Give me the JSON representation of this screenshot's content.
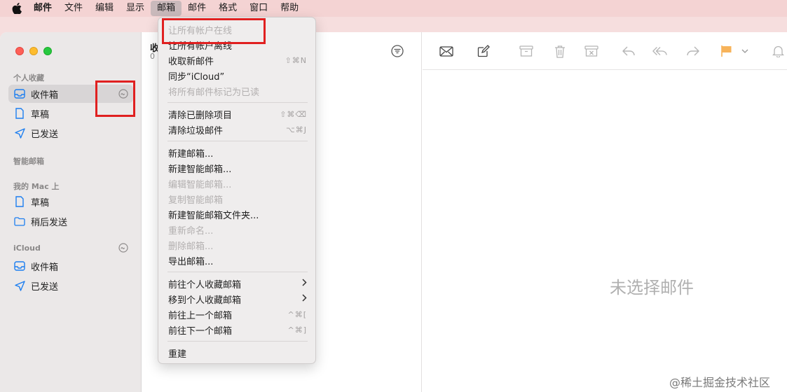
{
  "menubar": {
    "items": [
      "邮件",
      "文件",
      "编辑",
      "显示",
      "邮箱",
      "邮件",
      "格式",
      "窗口",
      "帮助"
    ]
  },
  "sidebar": {
    "sections": {
      "favorites": "个人收藏",
      "smart": "智能邮箱",
      "mac": "我的 Mac 上",
      "icloud": "iCloud"
    },
    "favorites": [
      {
        "label": "收件箱",
        "icon": "inbox-icon"
      },
      {
        "label": "草稿",
        "icon": "draft-icon"
      },
      {
        "label": "已发送",
        "icon": "sent-icon"
      }
    ],
    "mac": [
      {
        "label": "草稿",
        "icon": "draft-icon"
      },
      {
        "label": "稍后发送",
        "icon": "folder-icon"
      }
    ],
    "icloud": [
      {
        "label": "收件箱",
        "icon": "inbox-icon"
      },
      {
        "label": "已发送",
        "icon": "sent-icon"
      }
    ]
  },
  "message_list": {
    "title": "收",
    "subtitle": "0"
  },
  "viewer": {
    "empty_text": "未选择邮件"
  },
  "mailbox_menu": {
    "items": [
      {
        "label": "让所有帐户在线",
        "shortcut": "",
        "disabled": true
      },
      {
        "label": "让所有帐户离线",
        "shortcut": "",
        "disabled": false
      },
      {
        "label": "收取新邮件",
        "shortcut": "⇧⌘N",
        "disabled": false
      },
      {
        "label": "同步“iCloud”",
        "shortcut": "",
        "disabled": false
      },
      {
        "label": "将所有邮件标记为已读",
        "shortcut": "",
        "disabled": true
      },
      {
        "label": "清除已删除项目",
        "shortcut": "⇧⌘⌫",
        "disabled": false
      },
      {
        "label": "清除垃圾邮件",
        "shortcut": "⌥⌘J",
        "disabled": false
      },
      {
        "label": "新建邮箱...",
        "shortcut": "",
        "disabled": false
      },
      {
        "label": "新建智能邮箱...",
        "shortcut": "",
        "disabled": false
      },
      {
        "label": "编辑智能邮箱...",
        "shortcut": "",
        "disabled": true
      },
      {
        "label": "复制智能邮箱",
        "shortcut": "",
        "disabled": true
      },
      {
        "label": "新建智能邮箱文件夹...",
        "shortcut": "",
        "disabled": false
      },
      {
        "label": "重新命名...",
        "shortcut": "",
        "disabled": true
      },
      {
        "label": "删除邮箱...",
        "shortcut": "",
        "disabled": true
      },
      {
        "label": "导出邮箱...",
        "shortcut": "",
        "disabled": false
      },
      {
        "label": "前往个人收藏邮箱",
        "shortcut": "›",
        "disabled": false
      },
      {
        "label": "移到个人收藏邮箱",
        "shortcut": "›",
        "disabled": false
      },
      {
        "label": "前往上一个邮箱",
        "shortcut": "^⌘[",
        "disabled": false
      },
      {
        "label": "前往下一个邮箱",
        "shortcut": "^⌘]",
        "disabled": false
      },
      {
        "label": "重建",
        "shortcut": "",
        "disabled": false
      }
    ]
  },
  "watermark": "@稀土掘金技术社区",
  "colors": {
    "menubar_bg": "#f4d3d3",
    "sidebar_bg": "#ebe8e8",
    "accent": "#1c7ef0",
    "annotation_red": "#e02020",
    "flag_orange": "#f7b35a"
  }
}
